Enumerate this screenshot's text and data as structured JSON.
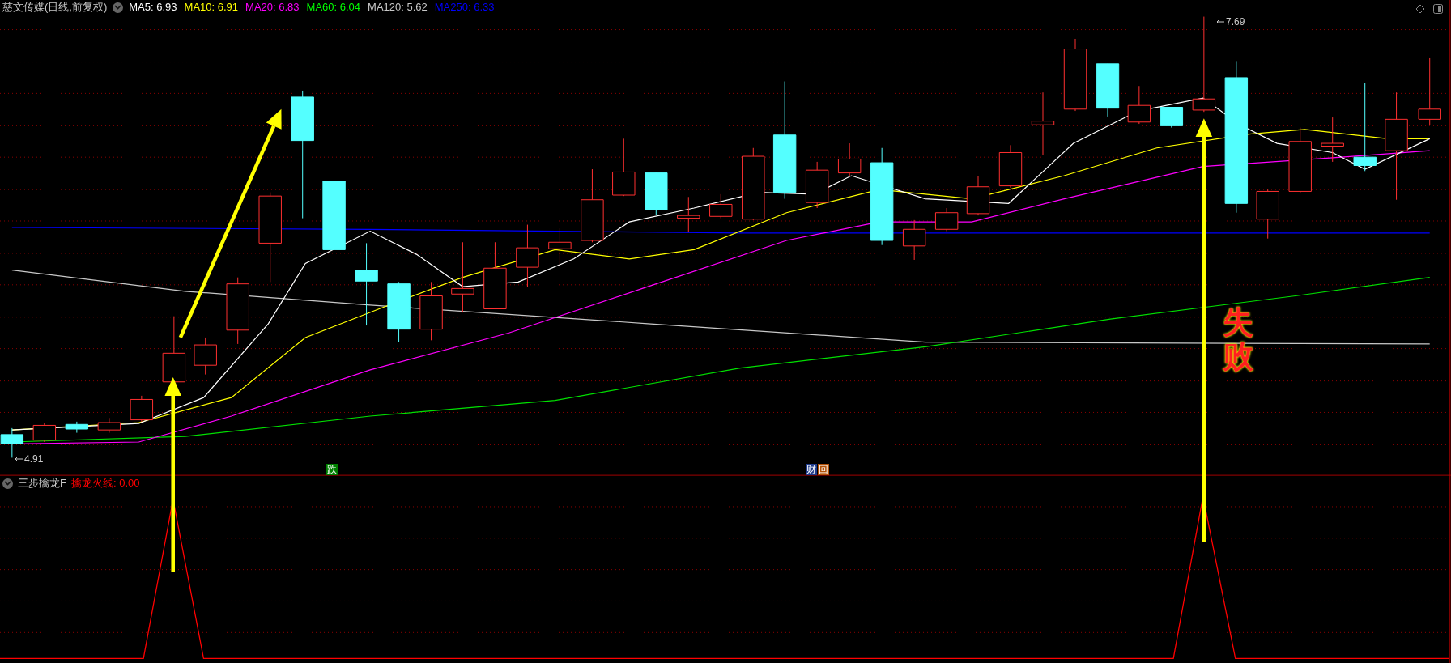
{
  "header": {
    "title": "慈文传媒(日线,前复权)",
    "indicators": [
      {
        "label": "MA5: 6.93",
        "color": "#ffffff"
      },
      {
        "label": "MA10: 6.91",
        "color": "#ffff00"
      },
      {
        "label": "MA20: 6.83",
        "color": "#ff00ff"
      },
      {
        "label": "MA60: 6.04",
        "color": "#00ff00"
      },
      {
        "label": "MA120: 5.62",
        "color": "#c8c8c8"
      },
      {
        "label": "MA250: 6.33",
        "color": "#0000ff"
      }
    ]
  },
  "price_labels": [
    {
      "kind": "high",
      "text": "7.69"
    },
    {
      "kind": "low",
      "text": "4.91"
    }
  ],
  "event_markers": [
    {
      "text": "跌",
      "color": "#008000"
    },
    {
      "text": "财",
      "color": "#1e3a8a"
    },
    {
      "text": "回",
      "color": "#b45309"
    }
  ],
  "indicator_panel": {
    "title": "三步擒龙F",
    "series": [
      {
        "label": "擒龙火线: 0.00",
        "color": "#ff0000"
      }
    ]
  },
  "annotation": {
    "text": "失败"
  }
}
